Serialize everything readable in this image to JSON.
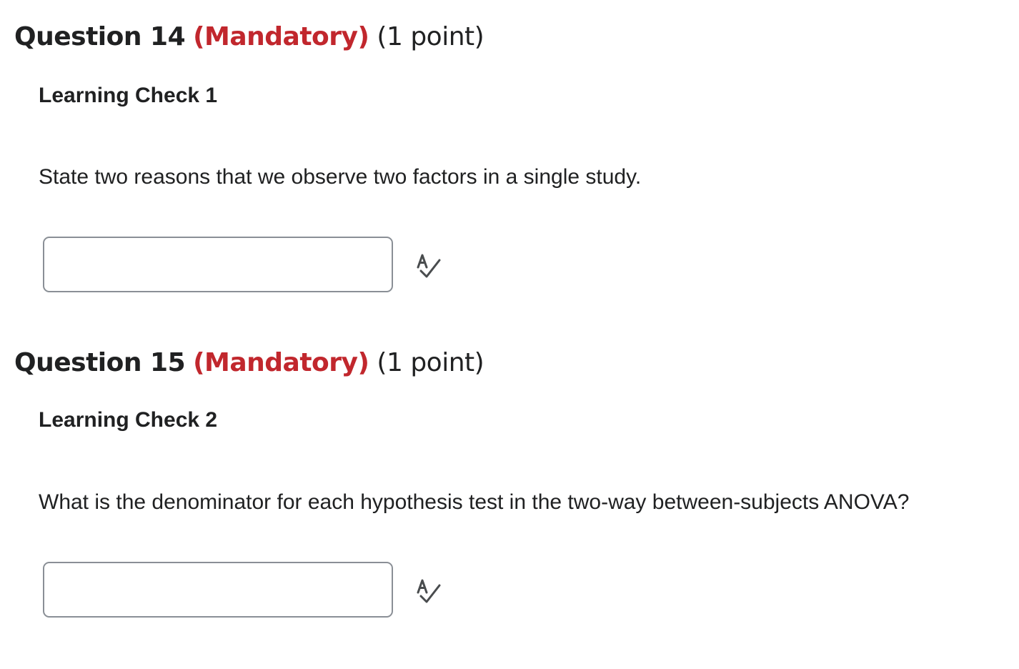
{
  "questions": [
    {
      "title": "Question 14",
      "mandatory": "(Mandatory)",
      "points": "(1 point)",
      "subtitle": "Learning Check 1",
      "prompt": "State two reasons that we observe two factors in a single study.",
      "answer_value": "",
      "spellcheck_icon": "spellcheck-icon"
    },
    {
      "title": "Question 15",
      "mandatory": "(Mandatory)",
      "points": "(1 point)",
      "subtitle": "Learning Check 2",
      "prompt": "What is the denominator for each hypothesis test in the two-way between-subjects ANOVA?",
      "answer_value": "",
      "spellcheck_icon": "spellcheck-icon"
    }
  ],
  "colors": {
    "mandatory": "#c1272d",
    "text": "#202122",
    "input_border": "#8a8f96",
    "icon": "#494c4e"
  }
}
